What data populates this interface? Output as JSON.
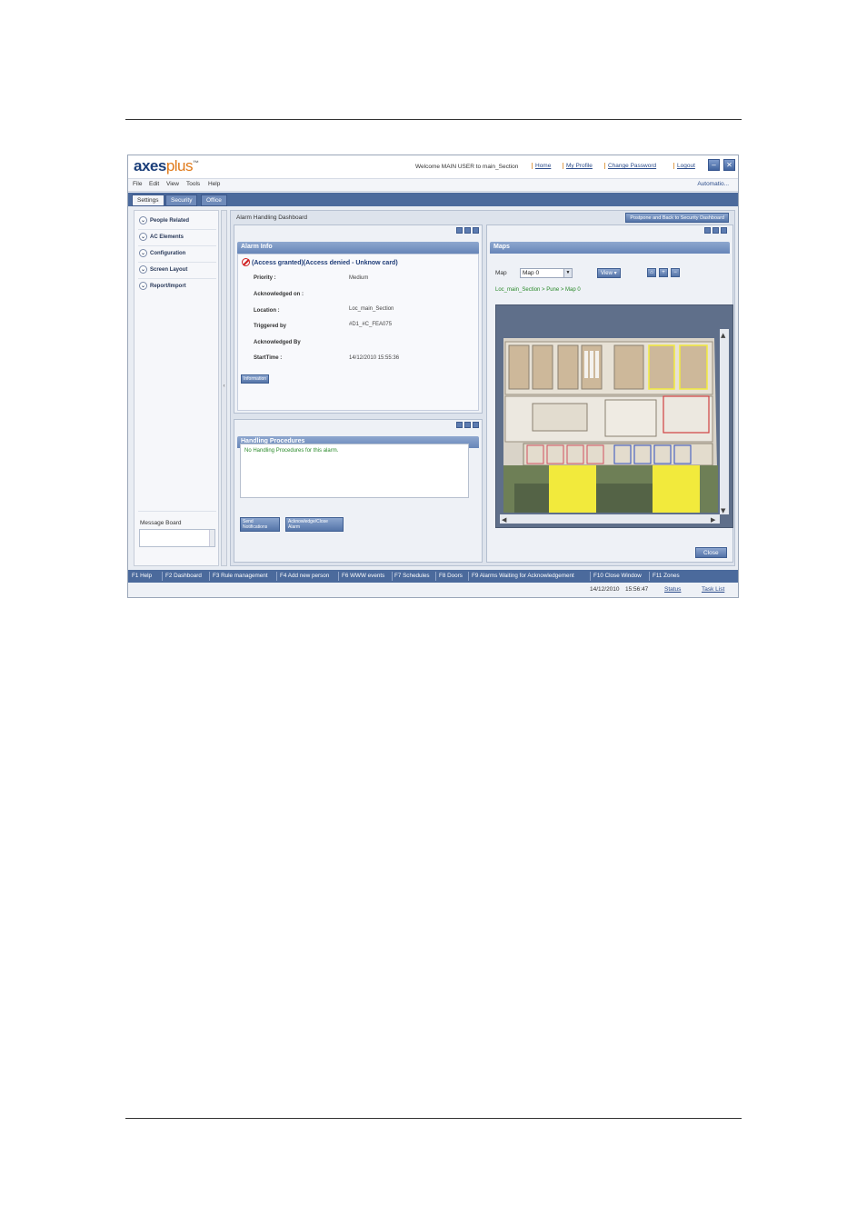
{
  "app": {
    "logo_main": "axes",
    "logo_accent": "plus",
    "logo_tm": "™",
    "welcome": "Welcome MAIN USER  to main_Section",
    "links": [
      "Home",
      "My Profile",
      "Change Password",
      "Logout"
    ],
    "minimize_glyph": "–",
    "close_glyph": "✕"
  },
  "menu": {
    "items": [
      "File",
      "Edit",
      "View",
      "Tools",
      "Help"
    ],
    "automation": "Automatio..."
  },
  "tabs": [
    "Settings",
    "Security",
    "Office"
  ],
  "sidebar": {
    "items": [
      "People Related",
      "AC Elements",
      "Configuration",
      "Screen Layout",
      "Report/Import"
    ],
    "message_board_label": "Message Board",
    "collapse_glyph": "‹"
  },
  "dashboard": {
    "title": "Alarm Handling Dashboard",
    "postpone_button": "Postpone and Back to Security Dashboard",
    "close_button": "Close"
  },
  "alarm_info": {
    "header": "Alarm Info",
    "title": "(Access granted)(Access denied - Unknow card)",
    "fields": [
      {
        "label": "Priority :",
        "value": "Medium"
      },
      {
        "label": "Acknowledged on :",
        "value": ""
      },
      {
        "label": "Location :",
        "value": "Loc_main_Section"
      },
      {
        "label": "Triggered by",
        "value": "#D1_#C_FEA075"
      },
      {
        "label": "Acknowledged By",
        "value": ""
      },
      {
        "label": "StartTime :",
        "value": "14/12/2010 15:55:36"
      }
    ],
    "info_button": "Information"
  },
  "handling": {
    "header": "Handling Procedures",
    "empty_text": "No Handling Procedures for this alarm.",
    "send_button": "Send Notifications",
    "ack_button": "Acknowledge/Close Alarm"
  },
  "maps": {
    "header": "Maps",
    "map_label": "Map",
    "map_value": "Map 0",
    "view_button": "View",
    "path": "Loc_main_Section > Pune > Map 0"
  },
  "fkeys": [
    "F1 Help",
    "F2 Dashboard",
    "F3 Rule management",
    "F4 Add new person",
    "F6 WWW events",
    "F7 Schedules",
    "F8 Doors",
    "F9 Alarms Waiting for Acknowledgement",
    "F10 Close Window",
    "F11 Zones"
  ],
  "status": {
    "date": "14/12/2010",
    "time": "15:56:47",
    "status_link": "Status",
    "tasklist_link": "Task List"
  },
  "colors": {
    "accent": "#4b6a9c",
    "logo_blue": "#1c3f7a",
    "logo_orange": "#e07a1a",
    "alarm_red": "#d02020",
    "info_green": "#2a8a2a",
    "highlight_yellow": "#f2ea3c"
  }
}
